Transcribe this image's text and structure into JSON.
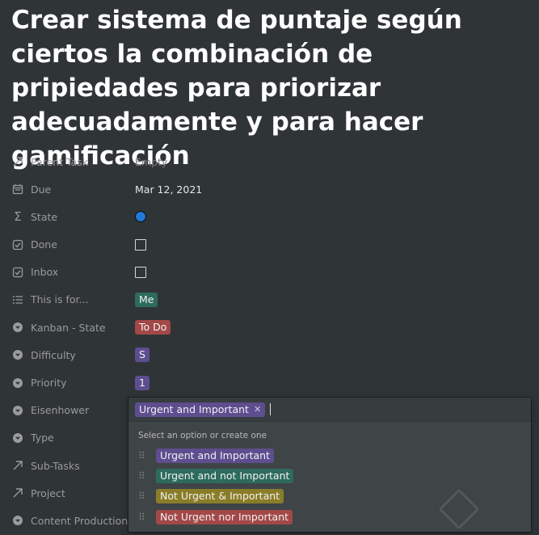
{
  "page": {
    "title": "Crear sistema de puntaje según ciertos la combinación de pripiedades para priorizar adecuadamente y para hacer gamificación"
  },
  "properties": [
    {
      "label": "Parent Task",
      "icon": "arrow-up-right-icon",
      "value": "Empty"
    },
    {
      "label": "Due",
      "icon": "calendar-icon",
      "value": "Mar 12, 2021"
    },
    {
      "label": "State",
      "icon": "sigma-icon",
      "value_color": "#1f79d5"
    },
    {
      "label": "Done",
      "icon": "checkbox-icon",
      "checked": false
    },
    {
      "label": "Inbox",
      "icon": "checkbox-icon",
      "checked": false
    },
    {
      "label": "This is for...",
      "icon": "list-icon",
      "value": "Me",
      "color": "#2d6b5e"
    },
    {
      "label": "Kanban - State",
      "icon": "select-icon",
      "value": "To Do",
      "color": "#a34848"
    },
    {
      "label": "Difficulty",
      "icon": "select-icon",
      "value": "S",
      "color": "#5e4d8f"
    },
    {
      "label": "Priority",
      "icon": "select-icon",
      "value": "1",
      "color": "#5e4d8f"
    },
    {
      "label": "Eisenhower",
      "icon": "select-icon"
    },
    {
      "label": "Type",
      "icon": "select-icon"
    },
    {
      "label": "Sub-Tasks",
      "icon": "arrow-up-right-icon"
    },
    {
      "label": "Project",
      "icon": "arrow-up-right-icon"
    },
    {
      "label": "Content Production",
      "icon": "select-icon"
    }
  ],
  "eisenhower_editor": {
    "selected": "Urgent and Important",
    "selected_color": "#5e4d8f",
    "hint": "Select an option or create one",
    "options": [
      {
        "label": "Urgent and Important",
        "color": "#5e4d8f"
      },
      {
        "label": "Urgent and not Important",
        "color": "#2d6b5e"
      },
      {
        "label": "Not Urgent & Important",
        "color": "#8a7d28"
      },
      {
        "label": "Not Urgent nor Important",
        "color": "#a34848"
      }
    ]
  }
}
